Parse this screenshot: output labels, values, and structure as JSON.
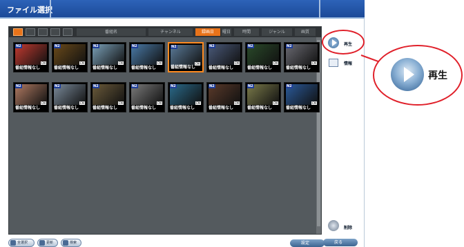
{
  "window": {
    "title": "ファイル選択"
  },
  "toolbar": {
    "columns": [
      "番組名",
      "チャンネル",
      "録画日",
      "曜日",
      "時間",
      "ジャンル",
      "画質"
    ],
    "active_column": "録画日"
  },
  "tiles": [
    {
      "caption": "番組情報なし",
      "color": "#c23a30",
      "selected": false
    },
    {
      "caption": "番組情報なし",
      "color": "#6a4a1a",
      "selected": false
    },
    {
      "caption": "番組情報なし",
      "color": "#7aa0b8",
      "selected": false
    },
    {
      "caption": "番組情報なし",
      "color": "#4a7aa8",
      "selected": false
    },
    {
      "caption": "番組情報なし",
      "color": "#5a7a98",
      "selected": true
    },
    {
      "caption": "番組情報なし",
      "color": "#4a5a7a",
      "selected": false
    },
    {
      "caption": "番組情報なし",
      "color": "#2a4a2a",
      "selected": false
    },
    {
      "caption": "番組情報なし",
      "color": "#6a6a72",
      "selected": false
    },
    {
      "caption": "番組情報なし",
      "color": "#b07a62",
      "selected": false
    },
    {
      "caption": "番組情報なし",
      "color": "#7a8a9a",
      "selected": false
    },
    {
      "caption": "番組情報なし",
      "color": "#6a5a3a",
      "selected": false
    },
    {
      "caption": "番組情報なし",
      "color": "#7a7a7a",
      "selected": false
    },
    {
      "caption": "番組情報なし",
      "color": "#2a6a8a",
      "selected": false
    },
    {
      "caption": "番組情報なし",
      "color": "#5a3a2a",
      "selected": false
    },
    {
      "caption": "番組情報なし",
      "color": "#7a7a4a",
      "selected": false
    },
    {
      "caption": "番組情報なし",
      "color": "#2a5a9a",
      "selected": false
    }
  ],
  "tile_badge": "N2",
  "tile_sub": "CM",
  "sidebar": {
    "play_label": "再生",
    "info_label": "情報",
    "delete_label": "削除"
  },
  "bottom": {
    "btn_select_all": "全選択",
    "btn_update": "更新",
    "btn_search": "検索",
    "btn_settings": "設定",
    "btn_back": "戻る"
  },
  "callout": {
    "label": "再生"
  }
}
